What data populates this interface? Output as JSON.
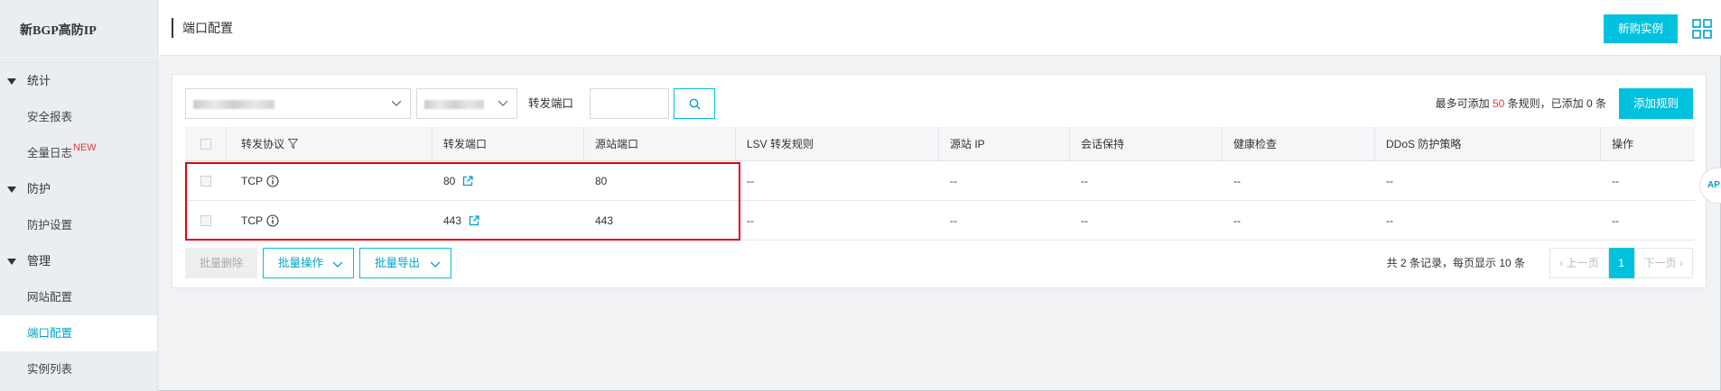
{
  "sidebar": {
    "brand": "新BGP高防IP",
    "groups": [
      {
        "label": "统计",
        "items": [
          {
            "label": "安全报表"
          },
          {
            "label": "全量日志",
            "badge": "NEW"
          }
        ]
      },
      {
        "label": "防护",
        "items": [
          {
            "label": "防护设置"
          }
        ]
      },
      {
        "label": "管理",
        "items": [
          {
            "label": "网站配置"
          },
          {
            "label": "端口配置",
            "active": true
          },
          {
            "label": "实例列表"
          }
        ]
      }
    ]
  },
  "header": {
    "title": "端口配置",
    "buy_button": "新购实例"
  },
  "toolbar": {
    "port_label": "转发端口",
    "port_value": "",
    "limit_prefix": "最多可添加",
    "limit_max": "50",
    "limit_suffix": "条规则，已添加 0 条",
    "add_button": "添加规则"
  },
  "table": {
    "headers": [
      "转发协议",
      "转发端口",
      "源站端口",
      "LSV 转发规则",
      "源站 IP",
      "会话保持",
      "健康检查",
      "DDoS 防护策略",
      "操作"
    ],
    "rows": [
      {
        "protocol": "TCP",
        "forward_port": "80",
        "origin_port": "80",
        "lsv": "--",
        "origin_ip": "--",
        "session": "--",
        "health": "--",
        "ddos": "--",
        "actions": "--"
      },
      {
        "protocol": "TCP",
        "forward_port": "443",
        "origin_port": "443",
        "lsv": "--",
        "origin_ip": "--",
        "session": "--",
        "health": "--",
        "ddos": "--",
        "actions": "--"
      }
    ]
  },
  "footer": {
    "batch_delete": "批量删除",
    "batch_ops": "批量操作",
    "batch_export": "批量导出",
    "page_info": "共 2 条记录，每页显示 10 条",
    "prev": "上一页",
    "current_page": "1",
    "next": "下一页"
  },
  "side_tab": "AP",
  "colors": {
    "accent": "#00c1de",
    "highlight": "#e3000f",
    "limit_red": "#e4393c"
  }
}
